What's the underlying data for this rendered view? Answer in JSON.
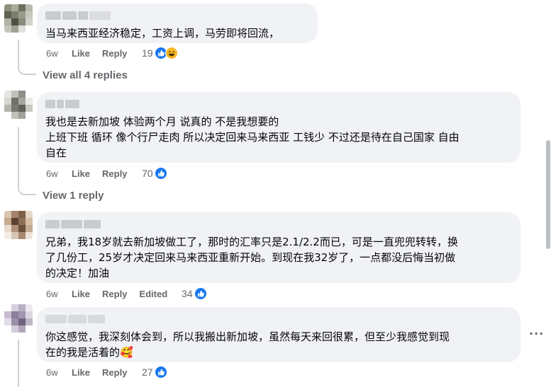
{
  "comments": [
    {
      "text": "当马来西亚经济稳定，工资上调，马劳即将回流，",
      "time": "6w",
      "like_label": "Like",
      "reply_label": "Reply",
      "reaction_count": "19",
      "reactions": [
        "like-icon",
        "haha-icon"
      ],
      "view_replies": "View all 4 replies"
    },
    {
      "text": "我也是去新加坡 体验两个月 说真的 不是我想要的\n上班下班 循环 像个行尸走肉 所以决定回来马来西亚 工钱少 不过还是待在自己国家 自由\n自在",
      "time": "6w",
      "like_label": "Like",
      "reply_label": "Reply",
      "reaction_count": "70",
      "reactions": [
        "like-icon"
      ],
      "view_replies": "View 1 reply"
    },
    {
      "text": "兄弟，我18岁就去新加坡做工了，那时的汇率只是2.1/2.2而已，可是一直兜兜转转，换\n了几份工，25岁才决定回来马来西亚重新开始。到现在我32岁了，一点都没后悔当初做\n的决定！加油",
      "time": "6w",
      "like_label": "Like",
      "reply_label": "Reply",
      "edited_label": "Edited",
      "reaction_count": "34",
      "reactions": [
        "like-icon"
      ]
    },
    {
      "text": "你这感觉，我深刻体会到，所以我搬出新加坡，虽然每天来回很累，但至少我感觉到现\n在的我是活着的🥰",
      "time": "6w",
      "like_label": "Like",
      "reply_label": "Reply",
      "reaction_count": "27",
      "reactions": [
        "like-icon"
      ],
      "more_label": "···"
    }
  ],
  "colors": {
    "bubble": "#f0f2f5",
    "like_blue": "#1877f2",
    "meta_gray": "#65676b"
  }
}
